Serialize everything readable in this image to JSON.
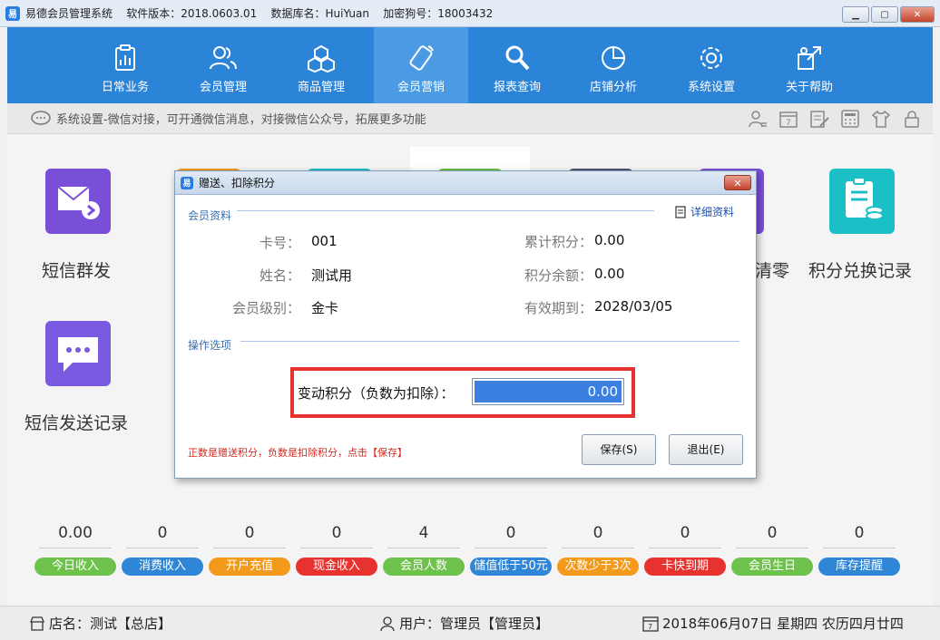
{
  "window": {
    "title": "易德会员管理系统    软件版本：2018.0603.01    数据库名：HuiYuan    加密狗号：18003432"
  },
  "nav": {
    "items": [
      {
        "label": "日常业务",
        "icon": "clipboard-chart-icon"
      },
      {
        "label": "会员管理",
        "icon": "users-icon"
      },
      {
        "label": "商品管理",
        "icon": "boxes-icon"
      },
      {
        "label": "会员营销",
        "icon": "phone-tilt-icon"
      },
      {
        "label": "报表查询",
        "icon": "magnifier-icon"
      },
      {
        "label": "店铺分析",
        "icon": "pie-chart-icon"
      },
      {
        "label": "系统设置",
        "icon": "gear-icon"
      },
      {
        "label": "关于帮助",
        "icon": "help-icon"
      }
    ],
    "active_index": 3
  },
  "notice": {
    "text": "系统设置-微信对接，可开通微信消息，对接微信公众号，拓展更多功能"
  },
  "tiles": [
    {
      "label": "短信群发",
      "color": "#7a4fd8"
    },
    {
      "label": "短信发送记录",
      "color": "#7a5ae0"
    },
    {
      "label": "积分兑换记录",
      "color": "#1bc0c6"
    },
    {
      "label": "清零",
      "color": "#7a4fd8"
    }
  ],
  "stats": [
    {
      "value": "0.00",
      "label": "今日收入",
      "color": "#6cc24a"
    },
    {
      "value": "0",
      "label": "消费收入",
      "color": "#2f86d6"
    },
    {
      "value": "0",
      "label": "开户充值",
      "color": "#f39a1b"
    },
    {
      "value": "0",
      "label": "现金收入",
      "color": "#e8322f"
    },
    {
      "value": "4",
      "label": "会员人数",
      "color": "#6cc24a"
    },
    {
      "value": "0",
      "label": "储值低于50元",
      "color": "#2f86d6"
    },
    {
      "value": "0",
      "label": "次数少于3次",
      "color": "#f39a1b"
    },
    {
      "value": "0",
      "label": "卡快到期",
      "color": "#e8322f"
    },
    {
      "value": "0",
      "label": "会员生日",
      "color": "#6cc24a"
    },
    {
      "value": "0",
      "label": "库存提醒",
      "color": "#2f86d6"
    }
  ],
  "status": {
    "store": "店名：测试【总店】",
    "user": "用户：管理员【管理员】",
    "date": "2018年06月07日 星期四 农历四月廿四"
  },
  "dialog": {
    "title": "赠送、扣除积分",
    "close_label": "✕",
    "section1": "会员资料",
    "detail_link": "详细资料",
    "fields": {
      "card_label": "卡号：",
      "card_value": "001",
      "name_label": "姓名：",
      "name_value": "测试用",
      "level_label": "会员级别：",
      "level_value": "金卡",
      "total_label": "累计积分：",
      "total_value": "0.00",
      "balance_label": "积分余额：",
      "balance_value": "0.00",
      "expire_label": "有效期到：",
      "expire_value": "2028/03/05"
    },
    "section2": "操作选项",
    "change_label": "变动积分（负数为扣除）：",
    "change_value": "0.00",
    "hint": "正数是赠送积分，负数是扣除积分，点击【保存】",
    "save_label": "保存(S)",
    "exit_label": "退出(E)"
  }
}
